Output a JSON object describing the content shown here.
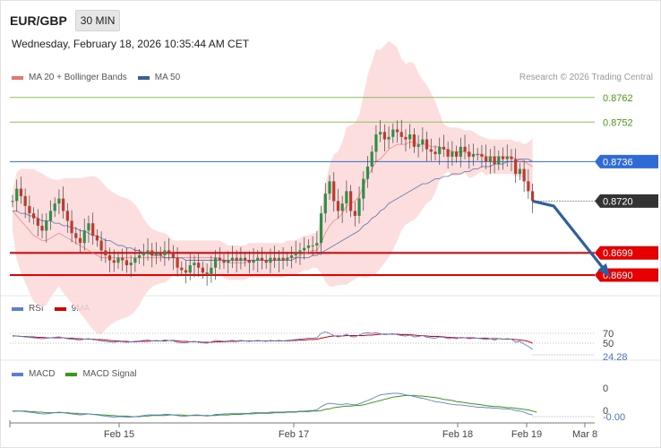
{
  "header": {
    "pair": "EUR/GBP",
    "timeframe": "30 MIN",
    "datetime": "Wednesday, February 18, 2026 10:35:44 AM CET",
    "credit": "Research © 2026 Trading Central"
  },
  "colors": {
    "ma20": "#f07070",
    "ma50": "#3a5fa0",
    "band_fill": "#fdd8d8",
    "up_candle": "#2f8f47",
    "down_candle": "#c0392b",
    "resistance": "#8dc05a",
    "support": "#e60000",
    "pivot": "#2f6bd6",
    "last": "#333333",
    "forecast_arrow": "#2e5fa0",
    "rsi": "#5a7fd6",
    "rsi_ma": "#e00000",
    "macd": "#5a7fd6",
    "macd_signal": "#3a9a14"
  },
  "legend": {
    "ma20": "MA 20 + Bollinger Bands",
    "ma50": "MA 50",
    "rsi": "RSI",
    "rsi_ma": "9MA",
    "macd": "MACD",
    "macd_signal": "MACD Signal"
  },
  "chart_data": [
    {
      "type": "candlestick",
      "pair": "EUR/GBP",
      "interval": "30 MIN",
      "x_ticks": [
        "Feb 15",
        "Feb 17",
        "Feb 18",
        "Feb 19",
        "Mar 8"
      ],
      "ylim": [
        0.8686,
        0.8767
      ],
      "levels": [
        {
          "value": 0.8762,
          "label": "0.8762",
          "kind": "resistance"
        },
        {
          "value": 0.8752,
          "label": "0.8752",
          "kind": "resistance"
        },
        {
          "value": 0.8736,
          "label": "0.8736",
          "kind": "pivot"
        },
        {
          "value": 0.872,
          "label": "0.8720",
          "kind": "last"
        },
        {
          "value": 0.8699,
          "label": "0.8699",
          "kind": "support"
        },
        {
          "value": 0.869,
          "label": "0.8690",
          "kind": "support"
        }
      ],
      "close": [
        0.872,
        0.8725,
        0.8722,
        0.8718,
        0.8715,
        0.8713,
        0.871,
        0.8708,
        0.8712,
        0.8716,
        0.8719,
        0.8721,
        0.8716,
        0.8712,
        0.8707,
        0.8705,
        0.8703,
        0.8708,
        0.8711,
        0.8706,
        0.8704,
        0.87,
        0.8698,
        0.8696,
        0.8695,
        0.8697,
        0.8696,
        0.8694,
        0.8695,
        0.8697,
        0.8698,
        0.8699,
        0.87,
        0.8698,
        0.8699,
        0.8698,
        0.87,
        0.8699,
        0.8697,
        0.8693,
        0.8692,
        0.8691,
        0.8694,
        0.8695,
        0.8693,
        0.8691,
        0.869,
        0.8693,
        0.8697,
        0.8696,
        0.8695,
        0.8696,
        0.8697,
        0.8696,
        0.8697,
        0.8696,
        0.8695,
        0.8696,
        0.8697,
        0.8696,
        0.8695,
        0.8697,
        0.8696,
        0.8697,
        0.8696,
        0.8697,
        0.8698,
        0.8699,
        0.87,
        0.8701,
        0.8702,
        0.8702,
        0.8703,
        0.8715,
        0.8723,
        0.8728,
        0.872,
        0.8716,
        0.8719,
        0.8724,
        0.8716,
        0.8714,
        0.8721,
        0.8729,
        0.8734,
        0.874,
        0.8747,
        0.8748,
        0.8745,
        0.8746,
        0.8749,
        0.8748,
        0.8746,
        0.8745,
        0.8747,
        0.8742,
        0.8743,
        0.8745,
        0.8741,
        0.874,
        0.8739,
        0.8742,
        0.8741,
        0.8738,
        0.874,
        0.8738,
        0.8742,
        0.874,
        0.8738,
        0.8739,
        0.8739,
        0.8738,
        0.8736,
        0.8738,
        0.8735,
        0.8738,
        0.8737,
        0.8738,
        0.8737,
        0.8731,
        0.8733,
        0.8728,
        0.8724,
        0.872
      ],
      "ma20": [
        0.8716,
        0.8714,
        0.8712,
        0.871,
        0.8708,
        0.8706,
        0.8705,
        0.8704,
        0.8704,
        0.8705,
        0.8706,
        0.8707,
        0.8706,
        0.8705,
        0.8704,
        0.8703,
        0.8702,
        0.8701,
        0.87,
        0.8699,
        0.8698,
        0.8697,
        0.8697,
        0.8697,
        0.8697,
        0.8697,
        0.8697,
        0.8697,
        0.8697,
        0.8697,
        0.8697,
        0.8697,
        0.8697,
        0.8697,
        0.8697,
        0.8697,
        0.8697,
        0.8697,
        0.8697,
        0.8697,
        0.8697,
        0.8697,
        0.8697,
        0.8697,
        0.8697,
        0.8697,
        0.8697,
        0.8697,
        0.8697,
        0.8697,
        0.8696,
        0.8695,
        0.8695,
        0.8695,
        0.8695,
        0.8695,
        0.8696,
        0.8696,
        0.8696,
        0.8696,
        0.8696,
        0.8696,
        0.8696,
        0.8696,
        0.8696,
        0.8697,
        0.8697,
        0.8697,
        0.8698,
        0.8699,
        0.8699,
        0.87,
        0.87,
        0.8703,
        0.8707,
        0.871,
        0.8712,
        0.8713,
        0.8715,
        0.8718,
        0.8719,
        0.872,
        0.8722,
        0.8726,
        0.873,
        0.8733,
        0.8736,
        0.8737,
        0.8739,
        0.8741,
        0.8742,
        0.8743,
        0.8743,
        0.8743,
        0.8744,
        0.8744,
        0.8743,
        0.8743,
        0.8743,
        0.8742,
        0.8742,
        0.8742,
        0.8741,
        0.8741,
        0.874,
        0.874,
        0.874,
        0.874,
        0.8739,
        0.8739,
        0.8739,
        0.8739,
        0.8738,
        0.8738,
        0.8738,
        0.8738,
        0.8738,
        0.8738,
        0.8738,
        0.8737,
        0.8737,
        0.8736,
        0.8735,
        0.8734
      ],
      "ma50": [
        0.8716,
        0.8716,
        0.8715,
        0.8715,
        0.8714,
        0.8714,
        0.8713,
        0.8712,
        0.8712,
        0.8712,
        0.8711,
        0.8711,
        0.871,
        0.871,
        0.8709,
        0.8709,
        0.8708,
        0.8708,
        0.8707,
        0.8706,
        0.8706,
        0.8705,
        0.8704,
        0.8704,
        0.8703,
        0.8702,
        0.8702,
        0.8701,
        0.8701,
        0.87,
        0.87,
        0.8699,
        0.8699,
        0.8698,
        0.8698,
        0.8698,
        0.8697,
        0.8697,
        0.8697,
        0.8697,
        0.8697,
        0.8696,
        0.8696,
        0.8696,
        0.8696,
        0.8696,
        0.8696,
        0.8696,
        0.8696,
        0.8696,
        0.8696,
        0.8696,
        0.8696,
        0.8696,
        0.8696,
        0.8696,
        0.8696,
        0.8696,
        0.8696,
        0.8696,
        0.8696,
        0.8696,
        0.8696,
        0.8696,
        0.8696,
        0.8696,
        0.8696,
        0.8697,
        0.8697,
        0.8697,
        0.8697,
        0.8698,
        0.8698,
        0.8699,
        0.87,
        0.8701,
        0.8702,
        0.8703,
        0.8704,
        0.8705,
        0.8706,
        0.8707,
        0.8708,
        0.871,
        0.8711,
        0.8713,
        0.8714,
        0.8716,
        0.8717,
        0.8719,
        0.872,
        0.8721,
        0.8722,
        0.8723,
        0.8724,
        0.8725,
        0.8726,
        0.8727,
        0.8727,
        0.8728,
        0.8729,
        0.8729,
        0.873,
        0.873,
        0.8731,
        0.8731,
        0.8731,
        0.8732,
        0.8732,
        0.8733,
        0.8733,
        0.8734,
        0.8734,
        0.8734,
        0.8735,
        0.8735,
        0.8735,
        0.8736,
        0.8736,
        0.8736,
        0.8737,
        0.8737,
        0.8737,
        0.8736
      ],
      "forecast": [
        {
          "x": 123,
          "y": 0.872
        },
        {
          "x": 128,
          "y": 0.8718
        },
        {
          "x": 141,
          "y": 0.869
        }
      ]
    },
    {
      "type": "line",
      "name": "RSI",
      "y_ticks": [
        70,
        50
      ],
      "last_value": "24.28",
      "rsi": [
        55,
        54,
        53,
        52,
        51,
        50,
        49,
        48,
        49,
        50,
        51,
        52,
        50,
        48,
        47,
        46,
        45,
        47,
        48,
        46,
        45,
        43,
        42,
        41,
        40,
        42,
        41,
        40,
        41,
        42,
        43,
        44,
        45,
        43,
        44,
        43,
        45,
        44,
        43,
        40,
        39,
        39,
        41,
        42,
        40,
        39,
        38,
        41,
        44,
        43,
        42,
        43,
        44,
        43,
        44,
        43,
        42,
        43,
        44,
        43,
        42,
        44,
        43,
        44,
        43,
        44,
        45,
        46,
        47,
        48,
        49,
        49,
        50,
        60,
        63,
        60,
        55,
        52,
        54,
        58,
        53,
        52,
        56,
        60,
        61,
        60,
        61,
        59,
        57,
        58,
        59,
        57,
        55,
        54,
        56,
        52,
        53,
        55,
        51,
        50,
        49,
        52,
        51,
        48,
        50,
        48,
        51,
        50,
        48,
        49,
        49,
        48,
        46,
        48,
        45,
        48,
        47,
        48,
        47,
        40,
        42,
        36,
        31,
        24.28
      ],
      "rsi_ma": [
        54,
        54,
        53,
        53,
        52,
        52,
        51,
        51,
        50,
        50,
        50,
        50,
        50,
        49,
        49,
        48,
        48,
        47,
        47,
        47,
        46,
        46,
        45,
        44,
        43,
        43,
        42,
        42,
        41,
        41,
        42,
        42,
        42,
        43,
        43,
        43,
        43,
        44,
        44,
        43,
        42,
        42,
        41,
        41,
        41,
        40,
        40,
        40,
        41,
        41,
        41,
        42,
        42,
        42,
        43,
        43,
        43,
        43,
        43,
        43,
        43,
        43,
        43,
        43,
        43,
        43,
        44,
        44,
        45,
        45,
        46,
        46,
        47,
        49,
        51,
        53,
        54,
        54,
        54,
        55,
        55,
        55,
        55,
        55,
        56,
        56,
        57,
        58,
        58,
        58,
        58,
        58,
        57,
        57,
        57,
        56,
        55,
        55,
        54,
        53,
        53,
        53,
        52,
        51,
        51,
        50,
        50,
        50,
        50,
        50,
        49,
        49,
        49,
        48,
        48,
        48,
        47,
        47,
        47,
        46,
        45,
        44,
        42,
        38
      ]
    },
    {
      "type": "line",
      "name": "MACD",
      "y_ticks": [
        0,
        0
      ],
      "last_value": "-0.00",
      "macd": [
        -6e-05,
        -5e-05,
        -5e-05,
        -6e-05,
        -7e-05,
        -8e-05,
        -9e-05,
        -0.0001,
        -0.0001,
        -9e-05,
        -8e-05,
        -7e-05,
        -8e-05,
        -9e-05,
        -0.0001,
        -0.00011,
        -0.00012,
        -0.00011,
        -0.0001,
        -0.00011,
        -0.00012,
        -0.00013,
        -0.00014,
        -0.00015,
        -0.00016,
        -0.00015,
        -0.00015,
        -0.00016,
        -0.00016,
        -0.00015,
        -0.00014,
        -0.00013,
        -0.00012,
        -0.00012,
        -0.00012,
        -0.00012,
        -0.00011,
        -0.00011,
        -0.00012,
        -0.00013,
        -0.00014,
        -0.00014,
        -0.00013,
        -0.00012,
        -0.00012,
        -0.00013,
        -0.00014,
        -0.00013,
        -0.00011,
        -0.00011,
        -0.0001,
        -0.0001,
        -9e-05,
        -9e-05,
        -9e-05,
        -9e-05,
        -9e-05,
        -8e-05,
        -8e-05,
        -8e-05,
        -8e-05,
        -7e-05,
        -7e-05,
        -7e-05,
        -7e-05,
        -6e-05,
        -6e-05,
        -6e-05,
        -5e-05,
        -5e-05,
        -4e-05,
        -4e-05,
        -3e-05,
        3e-05,
        7e-05,
        9e-05,
        8e-05,
        7e-05,
        7e-05,
        8e-05,
        7e-05,
        6e-05,
        8e-05,
        0.00011,
        0.00014,
        0.00017,
        0.00021,
        0.00024,
        0.00025,
        0.00026,
        0.00027,
        0.00027,
        0.00026,
        0.00024,
        0.00023,
        0.00021,
        0.00019,
        0.00018,
        0.00016,
        0.00014,
        0.00012,
        0.00011,
        0.0001,
        8e-05,
        7e-05,
        6e-05,
        6e-05,
        5e-05,
        4e-05,
        3e-05,
        2e-05,
        2e-05,
        1e-05,
        1e-05,
        0.0,
        0.0,
        -1e-05,
        -1e-05,
        -2e-05,
        -4e-05,
        -5e-05,
        -7e-05,
        -0.0001,
        -0.00012
      ],
      "macd_signal": [
        -5e-05,
        -5e-05,
        -5e-05,
        -5e-05,
        -6e-05,
        -6e-05,
        -7e-05,
        -7e-05,
        -8e-05,
        -8e-05,
        -8e-05,
        -8e-05,
        -8e-05,
        -8e-05,
        -9e-05,
        -9e-05,
        -0.0001,
        -0.0001,
        -0.0001,
        -0.00011,
        -0.00011,
        -0.00012,
        -0.00012,
        -0.00013,
        -0.00013,
        -0.00014,
        -0.00014,
        -0.00014,
        -0.00015,
        -0.00015,
        -0.00015,
        -0.00014,
        -0.00014,
        -0.00013,
        -0.00013,
        -0.00013,
        -0.00013,
        -0.00012,
        -0.00012,
        -0.00012,
        -0.00012,
        -0.00013,
        -0.00013,
        -0.00013,
        -0.00013,
        -0.00013,
        -0.00013,
        -0.00013,
        -0.00013,
        -0.00012,
        -0.00012,
        -0.00012,
        -0.00011,
        -0.00011,
        -0.00011,
        -0.0001,
        -0.0001,
        -0.0001,
        -9e-05,
        -9e-05,
        -9e-05,
        -9e-05,
        -8e-05,
        -8e-05,
        -8e-05,
        -7e-05,
        -7e-05,
        -7e-05,
        -6e-05,
        -6e-05,
        -6e-05,
        -5e-05,
        -5e-05,
        -4e-05,
        -2e-05,
        -1e-05,
        1e-05,
        2e-05,
        3e-05,
        4e-05,
        4e-05,
        5e-05,
        5e-05,
        6e-05,
        8e-05,
        0.0001,
        0.00012,
        0.00014,
        0.00016,
        0.00018,
        0.0002,
        0.00021,
        0.00022,
        0.00023,
        0.00023,
        0.00023,
        0.00022,
        0.00022,
        0.00021,
        0.0002,
        0.00019,
        0.00018,
        0.00016,
        0.00015,
        0.00014,
        0.00012,
        0.00011,
        0.0001,
        9e-05,
        8e-05,
        7e-05,
        6e-05,
        5e-05,
        4e-05,
        3e-05,
        3e-05,
        2e-05,
        1e-05,
        1e-05,
        0.0,
        -1e-05,
        -2e-05,
        -3e-05,
        -5e-05,
        -7e-05
      ]
    }
  ]
}
